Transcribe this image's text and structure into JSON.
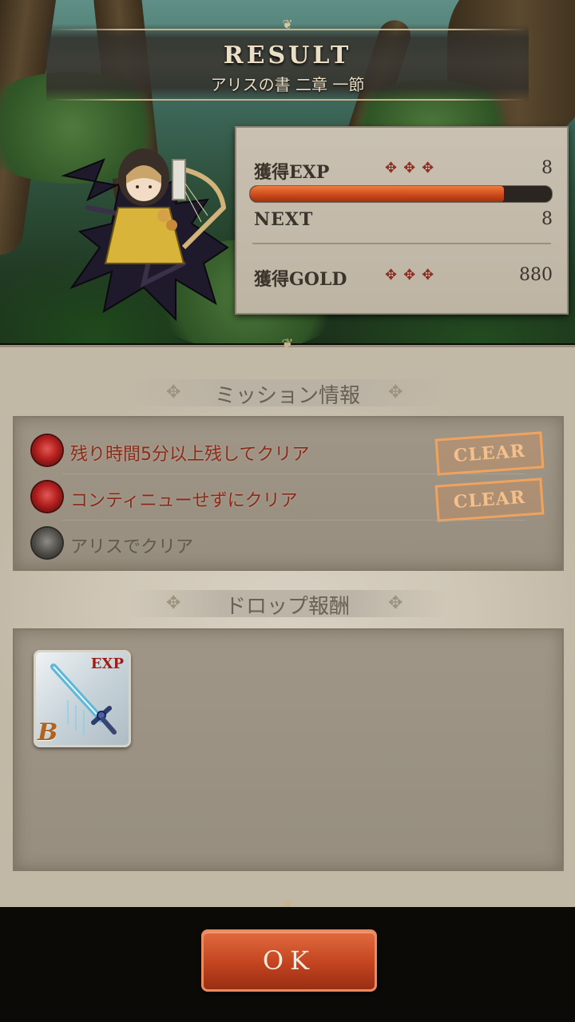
{
  "header": {
    "title": "RESULT",
    "stage": "アリスの書 二章 一節"
  },
  "stats": {
    "exp_label": "獲得EXP",
    "exp_dots": "✥✥✥",
    "exp_value": "8",
    "exp_progress_percent": 84,
    "next_label": "NEXT",
    "next_value": "8",
    "gold_label": "獲得GOLD",
    "gold_dots": "✥✥✥",
    "gold_value": "880"
  },
  "missions": {
    "heading": "ミッション情報",
    "items": [
      {
        "text": "残り時間5分以上残してクリア",
        "status": "CLEAR",
        "cleared": true
      },
      {
        "text": "コンティニューせずにクリア",
        "status": "CLEAR",
        "cleared": true
      },
      {
        "text": "アリスでクリア",
        "status": "",
        "cleared": false
      }
    ]
  },
  "drops": {
    "heading": "ドロップ報酬",
    "items": [
      {
        "icon": "sword-icon",
        "tag": "EXP",
        "grade": "B"
      }
    ]
  },
  "footer": {
    "ok_label": "OK"
  },
  "colors": {
    "accent": "#c24420",
    "clear_stamp": "#f0a35e",
    "mission_done_text": "#8a2a1a"
  }
}
